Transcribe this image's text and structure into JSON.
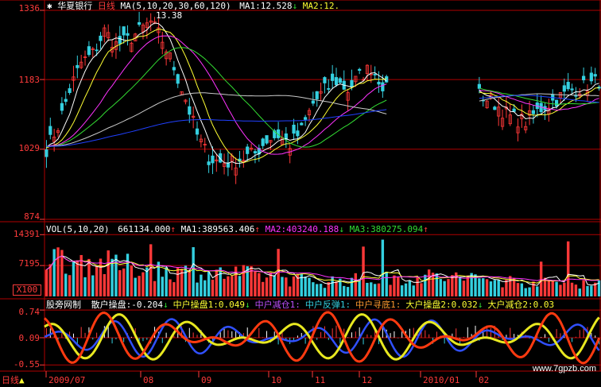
{
  "colors": {
    "frame": "#b00000",
    "up": "#ff3838",
    "down": "#34d0e0",
    "ma5": "#ffffff",
    "ma10": "#ffff33",
    "ma20": "#ff33ff",
    "ma30": "#33dd33",
    "ma60": "#c8c8c8",
    "ma120": "#2040ff",
    "label": "#ff3b3b",
    "wave_red": "#ff3a10",
    "wave_yellow": "#e8e820",
    "wave_blue": "#3050ff"
  },
  "price_panel": {
    "stock_name": "华夏银行",
    "period": "日线",
    "ma_label": "MA(5,10,20,30,60,120)",
    "ma1_label": "MA1:",
    "ma1_value": "12.528",
    "ma1_arrow": "↓",
    "ma2_label": "MA2:",
    "ma2_value": "12.",
    "y_labels": [
      "1336",
      "1183",
      "1029",
      "874"
    ],
    "annotation_high": "13.38",
    "star_icon": "✱"
  },
  "volume_panel": {
    "label": "VOL(5,10,20)",
    "value": "661134.000",
    "value_arrow": "↑",
    "ma1_label": "MA1:",
    "ma1_value": "389563.406",
    "ma1_arrow": "↑",
    "ma2_label": "MA2:",
    "ma2_value": "403240.188",
    "ma2_arrow": "↓",
    "ma3_label": "MA3:",
    "ma3_value": "380275.094",
    "ma3_arrow": "↑",
    "y_labels": [
      "14391",
      "7195",
      "X100"
    ]
  },
  "indicator_panel": {
    "name": "股旁网制",
    "items": [
      {
        "label": "散户操盘:",
        "value": "-0.204",
        "arrow": "↓",
        "color": "#ffffff"
      },
      {
        "label": "中户操盘1:",
        "value": "0.049",
        "arrow": "↓",
        "color": "#ffff33"
      },
      {
        "label": "中户减仓1:",
        "value": "",
        "arrow": "",
        "color": "#c050ff"
      },
      {
        "label": "中户反弹1:",
        "value": "",
        "arrow": "",
        "color": "#34d0e0"
      },
      {
        "label": "中户寻底1:",
        "value": "",
        "arrow": "",
        "color": "#ff9a30"
      },
      {
        "label": "大户操盘2:",
        "value": "0.032",
        "arrow": "↓",
        "color": "#ffff33"
      },
      {
        "label": "大户减仓2:",
        "value": "0.03",
        "arrow": "",
        "color": "#ffff33"
      }
    ],
    "y_labels": [
      "0.74",
      "0.09",
      "-0.55"
    ]
  },
  "x_axis": {
    "period_button": "日线",
    "labels": [
      "2009/07",
      "08",
      "09",
      "10",
      "11",
      "12",
      "2010/01",
      "02"
    ]
  },
  "watermark": "www.7gpzb.com",
  "chart_data": {
    "type": "candlestick",
    "title": "华夏银行 日线",
    "price_ylim": [
      8.74,
      13.36
    ],
    "price_ticks": [
      13.36,
      11.83,
      10.29,
      8.74
    ],
    "volume_ticks": [
      14391,
      7195
    ],
    "volume_unit": "X100",
    "indicator_ticks": [
      0.74,
      0.09,
      -0.55
    ],
    "x_labels": [
      "2009/07",
      "08",
      "09",
      "10",
      "11",
      "12",
      "2010/01",
      "02"
    ],
    "ma_periods": [
      5,
      10,
      20,
      30,
      60,
      120
    ],
    "price_path": [
      [
        0,
        10.3
      ],
      [
        3,
        10.8
      ],
      [
        6,
        11.6
      ],
      [
        9,
        12.2
      ],
      [
        12,
        12.4
      ],
      [
        15,
        12.9
      ],
      [
        18,
        12.6
      ],
      [
        21,
        12.7
      ],
      [
        24,
        12.9
      ],
      [
        27,
        13.1
      ],
      [
        30,
        12.7
      ],
      [
        33,
        12.1
      ],
      [
        36,
        11.4
      ],
      [
        39,
        10.6
      ],
      [
        42,
        10.1
      ],
      [
        45,
        10.0
      ],
      [
        48,
        10.0
      ],
      [
        51,
        10.1
      ],
      [
        54,
        10.2
      ],
      [
        57,
        10.5
      ],
      [
        60,
        10.6
      ],
      [
        63,
        10.4
      ],
      [
        66,
        10.7
      ],
      [
        69,
        11.3
      ],
      [
        72,
        11.6
      ],
      [
        75,
        11.8
      ],
      [
        78,
        11.6
      ],
      [
        81,
        11.9
      ],
      [
        84,
        12.1
      ],
      [
        88,
        11.6
      ],
      [
        92,
        11.6
      ],
      [
        96,
        11.5
      ],
      [
        100,
        11.7
      ],
      [
        104,
        11.6
      ],
      [
        108,
        11.6
      ],
      [
        112,
        11.5
      ],
      [
        116,
        11.3
      ],
      [
        120,
        11.0
      ],
      [
        124,
        10.9
      ],
      [
        128,
        11.2
      ],
      [
        132,
        11.4
      ],
      [
        136,
        11.6
      ],
      [
        140,
        11.7
      ],
      [
        143,
        11.8
      ]
    ],
    "price_breaks": [
      [
        88,
        112
      ]
    ],
    "volume_path": [
      [
        0,
        9200
      ],
      [
        10,
        8000
      ],
      [
        20,
        7000
      ],
      [
        30,
        6200
      ],
      [
        40,
        5000
      ],
      [
        50,
        5200
      ],
      [
        60,
        4400
      ],
      [
        70,
        3500
      ],
      [
        80,
        3800
      ],
      [
        90,
        4200
      ],
      [
        100,
        4600
      ],
      [
        110,
        4200
      ],
      [
        120,
        3600
      ],
      [
        130,
        3000
      ],
      [
        143,
        3400
      ]
    ],
    "volume_spikes": [
      [
        27,
        9000
      ],
      [
        38,
        8500
      ],
      [
        60,
        8200
      ],
      [
        82,
        8600
      ],
      [
        87,
        9800
      ],
      [
        128,
        6000
      ],
      [
        135,
        9500
      ]
    ]
  }
}
